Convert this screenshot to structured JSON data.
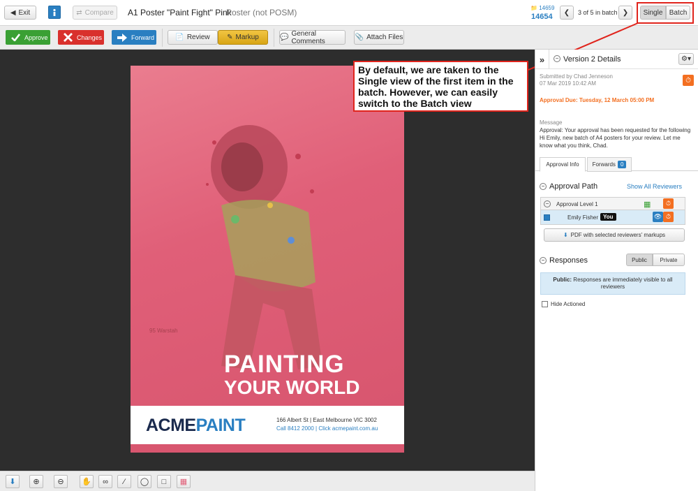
{
  "header": {
    "exit_label": "Exit",
    "compare_label": "Compare",
    "title": "A1 Poster \"Paint Fight\" Pink",
    "subtitle": "Poster (not POSM)",
    "job_number_small": "14659",
    "job_number": "14654",
    "batch_position": "3 of 5 in batch",
    "view_single": "Single",
    "view_batch": "Batch"
  },
  "toolbar": {
    "approve": "Approve",
    "changes": "Changes",
    "forward": "Forward",
    "review": "Review",
    "markup": "Markup",
    "general_comments": "General Comments",
    "attach_files": "Attach Files"
  },
  "poster": {
    "small_text": "95 Warstah",
    "headline_1": "PAINTING",
    "headline_2": "YOUR WORLD",
    "logo_acme": "ACME",
    "logo_paint": "PAINT",
    "address": "166 Albert St | East Melbourne VIC 3002",
    "contact": "Call 8412 2000 | Click acmepaint.com.au"
  },
  "callout": {
    "text": "By default, we are taken to the Single view of the first item in the batch.  However, we can easily switch to the Batch view"
  },
  "panel": {
    "version_title": "Version 2 Details",
    "submitted_by": "Submitted by Chad Jenneson",
    "submitted_date": "07 Mar 2019 10:42 AM",
    "approval_due": "Approval Due: Tuesday, 12 March 05:00 PM",
    "message_label": "Message",
    "message_body": "Approval: Your approval has been requested for the following Hi Emily, new batch of A4 posters for your review. Let me know what you think, Chad.",
    "tab_approval_info": "Approval Info",
    "tab_forwards": "Forwards",
    "forwards_count": "0",
    "approval_path_title": "Approval Path",
    "show_all_reviewers": "Show All Reviewers",
    "approval_level": "Approval Level 1",
    "reviewer_name": "Emily Fisher",
    "you_tag": "You",
    "pdf_button": "PDF with selected reviewers' markups",
    "responses_title": "Responses",
    "public_label": "Public",
    "private_label": "Private",
    "public_note_bold": "Public:",
    "public_note": " Responses are immediately visible to all reviewers",
    "hide_actioned": "Hide Actioned"
  },
  "colors": {
    "approve": "#3aa034",
    "changes": "#d9302c",
    "forward": "#2a7fc1",
    "markup_active": "#f2c542",
    "accent_orange": "#f36f21",
    "callout_border": "#e0241c"
  }
}
